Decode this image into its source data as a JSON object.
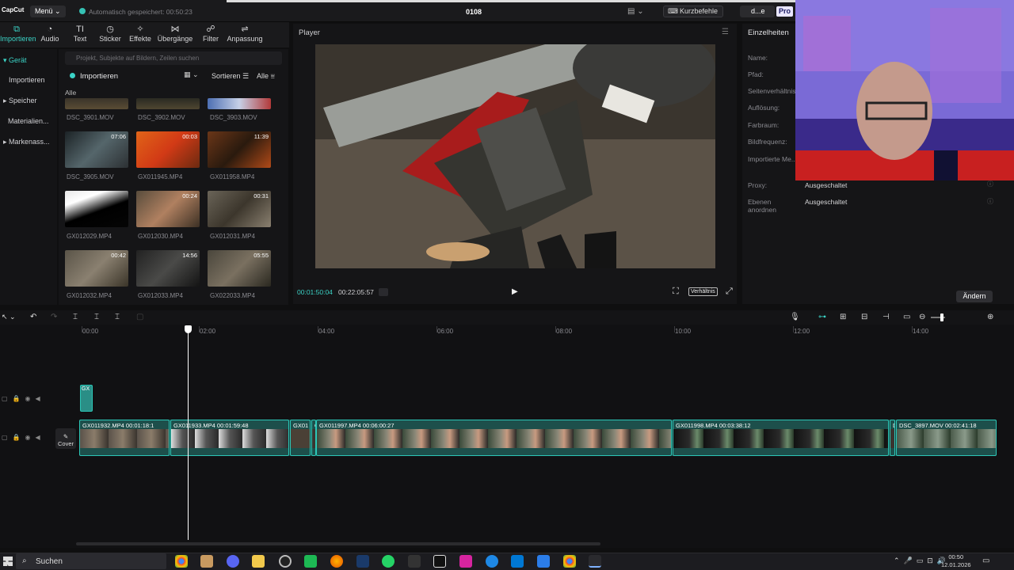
{
  "app": {
    "logo": "CapCut",
    "menu_label": "Menü",
    "autosave": "Automatisch gespeichert: 00:50:23",
    "project_title": "0108",
    "shortcuts_label": "Kurzbefehle",
    "user_label": "d...e",
    "pro_label": "Pro"
  },
  "toolbar": [
    {
      "label": "Importieren",
      "icon": "import-icon",
      "active": true
    },
    {
      "label": "Audio",
      "icon": "audio-icon"
    },
    {
      "label": "Text",
      "icon": "text-icon"
    },
    {
      "label": "Sticker",
      "icon": "sticker-icon"
    },
    {
      "label": "Effekte",
      "icon": "effects-icon"
    },
    {
      "label": "Übergänge",
      "icon": "transitions-icon"
    },
    {
      "label": "Filter",
      "icon": "filter-icon"
    },
    {
      "label": "Anpassung",
      "icon": "adjust-icon"
    }
  ],
  "leftnav": [
    {
      "label": "Gerät",
      "active": true
    },
    {
      "label": "Importieren"
    },
    {
      "label": "Speicher"
    },
    {
      "label": "Materialien..."
    },
    {
      "label": "Markenass..."
    }
  ],
  "media": {
    "search_placeholder": "Projekt, Subjekte auf Bildern, Zeilen suchen",
    "import_label": "Importieren",
    "sort_label": "Sortieren",
    "filter_label": "Alle",
    "all_label": "Alle",
    "items": [
      {
        "name": "DSC_3901.MOV",
        "duration": ""
      },
      {
        "name": "DSC_3902.MOV",
        "duration": ""
      },
      {
        "name": "DSC_3903.MOV",
        "duration": ""
      },
      {
        "name": "DSC_3905.MOV",
        "duration": "07:06"
      },
      {
        "name": "GX011945.MP4",
        "duration": "00:03"
      },
      {
        "name": "GX011958.MP4",
        "duration": "11:39"
      },
      {
        "name": "GX012029.MP4",
        "duration": ""
      },
      {
        "name": "GX012030.MP4",
        "duration": "00:24"
      },
      {
        "name": "GX012031.MP4",
        "duration": "00:31"
      },
      {
        "name": "GX012032.MP4",
        "duration": "00:42"
      },
      {
        "name": "GX012033.MP4",
        "duration": "14:56"
      },
      {
        "name": "GX022033.MP4",
        "duration": "05:55"
      }
    ]
  },
  "player": {
    "title": "Player",
    "current_time": "00:01:50:04",
    "total_time": "00:22:05:57",
    "ratio_label": "Verhältnis"
  },
  "details": {
    "title": "Einzelheiten",
    "fields": [
      {
        "label": "Name:"
      },
      {
        "label": "Pfad:"
      },
      {
        "label": "Seitenverhältnis:"
      },
      {
        "label": "Auflösung:"
      },
      {
        "label": "Farbraum:"
      },
      {
        "label": "Bildfrequenz:"
      },
      {
        "label": "Importierte Me..."
      }
    ],
    "proxy_label": "Proxy:",
    "proxy_value": "Ausgeschaltet",
    "layers_label": "Ebenen anordnen",
    "layers_value": "Ausgeschaltet",
    "change_label": "Ändern"
  },
  "timeline": {
    "ruler": [
      "00:00",
      "02:00",
      "04:00",
      "06:00",
      "08:00",
      "10:00",
      "12:00",
      "14:00"
    ],
    "cover_label": "Cover",
    "small_clip_label": "GX",
    "clips": [
      {
        "label": "GX011932.MP4  00:01:18:1"
      },
      {
        "label": "GX011933.MP4  00:01:59:48"
      },
      {
        "label": "GX01"
      },
      {
        "label": "G"
      },
      {
        "label": "GX011997.MP4  00:06:00:27"
      },
      {
        "label": "GX011998.MP4  00:03:38:12"
      },
      {
        "label": "D"
      },
      {
        "label": "DSC_3897.MOV  00:02:41:18"
      }
    ]
  },
  "taskbar": {
    "search_label": "Suchen",
    "time": "00:50",
    "date": "12.01.2026"
  }
}
